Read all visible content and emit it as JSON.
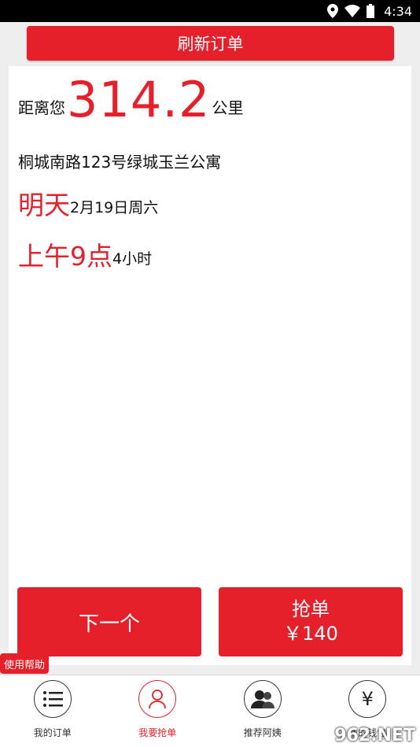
{
  "status_bar": {
    "time": "4:34"
  },
  "refresh_button": {
    "label": "刷新订单"
  },
  "order": {
    "distance_prefix": "距离您",
    "distance_value": "314.2",
    "distance_unit": "公里",
    "address": "桐城南路123号绿城玉兰公寓",
    "day_label": "明天",
    "date_text": "2月19日周六",
    "time_label": "上午9点",
    "duration_text": "4小时"
  },
  "actions": {
    "next_label": "下一个",
    "grab_label": "抢单",
    "grab_price": "￥140"
  },
  "help_button": {
    "label": "使用帮助"
  },
  "bottom_nav": {
    "items": [
      {
        "label": "我的订单",
        "icon": "list-icon",
        "active": false
      },
      {
        "label": "我要抢单",
        "icon": "person-icon",
        "active": true
      },
      {
        "label": "推荐阿姨",
        "icon": "people-icon",
        "active": false
      },
      {
        "label": "我的钱包",
        "icon": "yen-icon",
        "active": false
      }
    ]
  },
  "watermark": "962.NET",
  "colors": {
    "accent": "#e5202a",
    "status_bar": "#000000",
    "background": "#eeeeee"
  }
}
